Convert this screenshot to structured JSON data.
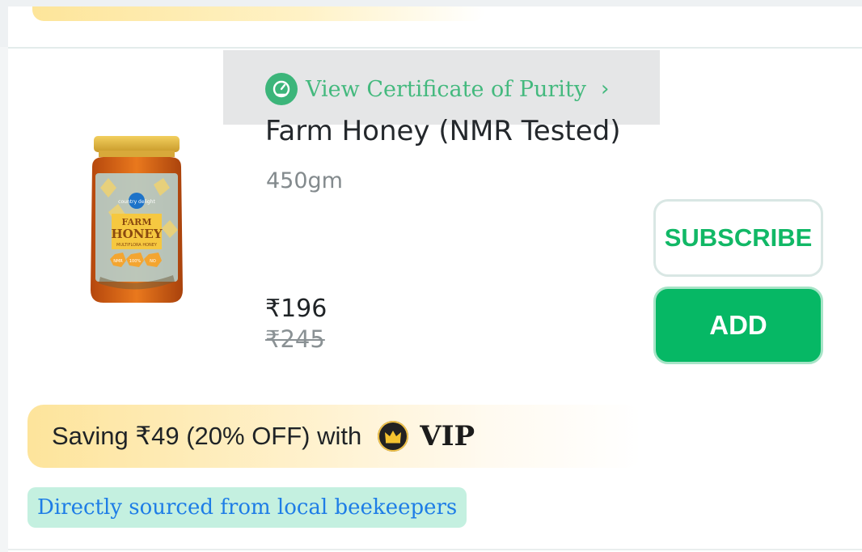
{
  "certificate": {
    "label": "View Certificate of Purity",
    "icon": "certificate-icon",
    "chevron": "›",
    "color": "#44b97e"
  },
  "product": {
    "title": "Farm Honey (NMR Tested)",
    "weight": "450gm",
    "price": "₹196",
    "mrp": "₹245",
    "image_alt": "Farm Honey jar",
    "jar_label": {
      "brand": "country delight",
      "name_line1": "FARM",
      "name_line2": "HONEY",
      "subline": "MULTIFLORA HONEY",
      "badges": [
        "NMR",
        "100%",
        "NO"
      ]
    }
  },
  "actions": {
    "subscribe_label": "SUBSCRIBE",
    "add_label": "ADD"
  },
  "offer": {
    "saving_text": "Saving ₹49 (20% OFF) with",
    "vip_label": "VIP"
  },
  "tag": {
    "text": "Directly sourced from local beekeepers"
  },
  "colors": {
    "accent_green": "#06b865",
    "tag_blue": "#1e7de6",
    "tag_bg": "#c4f0e0"
  }
}
